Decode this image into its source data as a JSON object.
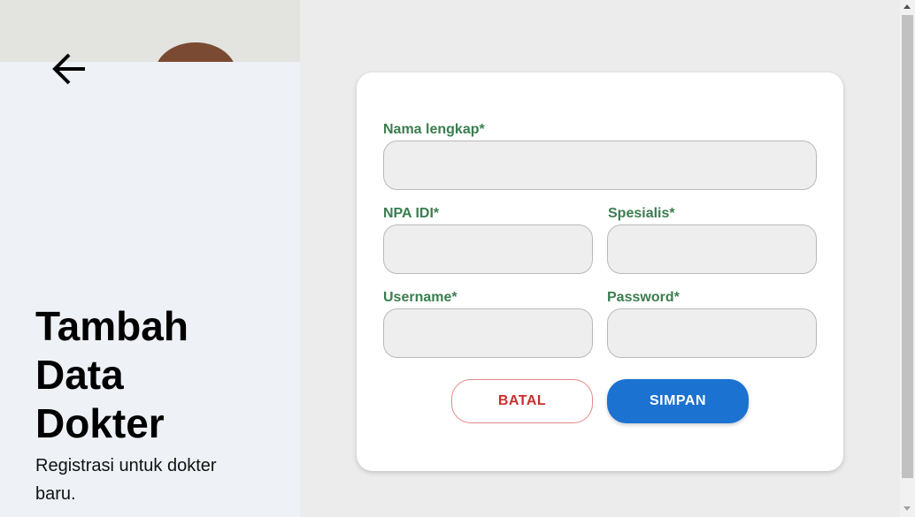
{
  "sidebar": {
    "title": "Tambah Data Dokter",
    "subtitle": "Registrasi untuk dokter baru.",
    "back_icon": "arrow-left-icon"
  },
  "form": {
    "fields": {
      "full_name": {
        "label": "Nama lengkap*",
        "value": ""
      },
      "npa_idi": {
        "label": "NPA IDI*",
        "value": ""
      },
      "specialist": {
        "label": "Spesialis*",
        "value": ""
      },
      "username": {
        "label": "Username*",
        "value": ""
      },
      "password": {
        "label": "Password*",
        "value": ""
      }
    },
    "buttons": {
      "cancel": "BATAL",
      "save": "SIMPAN"
    }
  },
  "colors": {
    "label": "#3a7d4f",
    "save_button": "#1b72d1",
    "cancel_text": "#c9302c",
    "left_panel_bg": "#eef1f6",
    "page_bg": "#ececec"
  }
}
